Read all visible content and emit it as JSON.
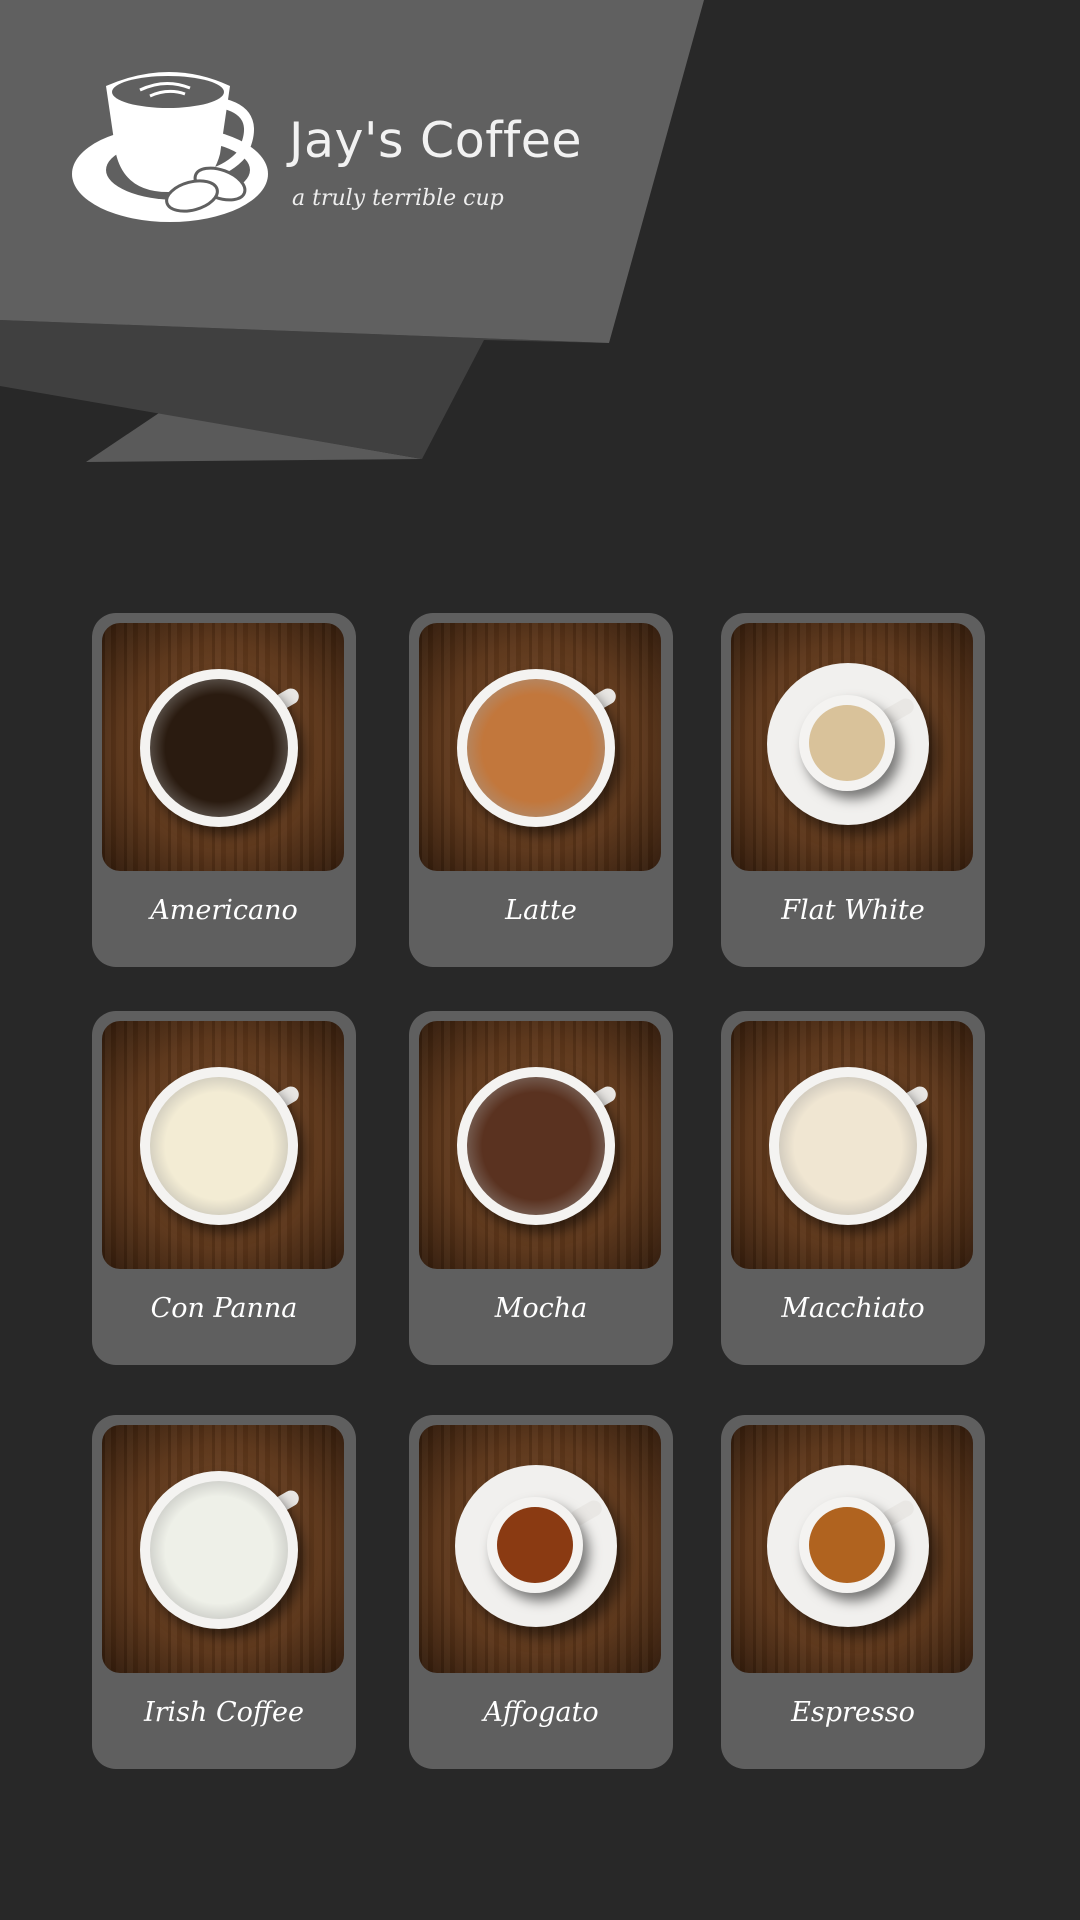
{
  "brand": {
    "title": "Jay's Coffee",
    "tagline": "a truly terrible cup",
    "logo_icon": "coffee-cup-with-beans-icon"
  },
  "colors": {
    "background": "#282828",
    "panel_light": "#606060",
    "panel_dark": "#404040",
    "card": "#5f5f5f",
    "text": "#ffffff"
  },
  "menu": [
    {
      "label": "Americano",
      "drink": "#2a1b10"
    },
    {
      "label": "Latte",
      "drink": "#c2773c"
    },
    {
      "label": "Flat White",
      "drink": "#d9c29a"
    },
    {
      "label": "Con Panna",
      "drink": "#f3ecd4"
    },
    {
      "label": "Mocha",
      "drink": "#5a3220"
    },
    {
      "label": "Macchiato",
      "drink": "#f0e6d2"
    },
    {
      "label": "Irish Coffee",
      "drink": "#eef0e8"
    },
    {
      "label": "Affogato",
      "drink": "#8a3a12"
    },
    {
      "label": "Espresso",
      "drink": "#b0631f"
    }
  ]
}
